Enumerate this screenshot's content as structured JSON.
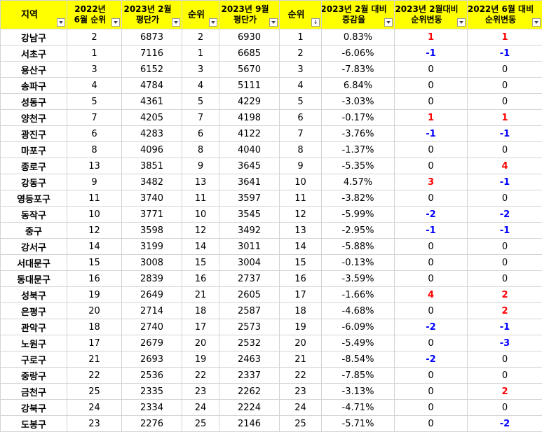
{
  "headers": [
    {
      "line1": "지역",
      "line2": ""
    },
    {
      "line1": "2022년",
      "line2": "6월 순위"
    },
    {
      "line1": "2023년 2월",
      "line2": "평단가"
    },
    {
      "line1": "순위",
      "line2": ""
    },
    {
      "line1": "2023년 9월",
      "line2": "평단가"
    },
    {
      "line1": "순위",
      "line2": ""
    },
    {
      "line1": "2023년 2월 대비",
      "line2": "증감율"
    },
    {
      "line1": "2023년 2월대비",
      "line2": "순위변동"
    },
    {
      "line1": "2022년 6월 대비",
      "line2": "순위변동"
    }
  ],
  "rows": [
    [
      "강남구",
      "2",
      "6873",
      "2",
      "6930",
      "1",
      "0.83%",
      "1",
      "1"
    ],
    [
      "서초구",
      "1",
      "7116",
      "1",
      "6685",
      "2",
      "-6.06%",
      "-1",
      "-1"
    ],
    [
      "용산구",
      "3",
      "6152",
      "3",
      "5670",
      "3",
      "-7.83%",
      "0",
      "0"
    ],
    [
      "송파구",
      "4",
      "4784",
      "4",
      "5111",
      "4",
      "6.84%",
      "0",
      "0"
    ],
    [
      "성동구",
      "5",
      "4361",
      "5",
      "4229",
      "5",
      "-3.03%",
      "0",
      "0"
    ],
    [
      "양천구",
      "7",
      "4205",
      "7",
      "4198",
      "6",
      "-0.17%",
      "1",
      "1"
    ],
    [
      "광진구",
      "6",
      "4283",
      "6",
      "4122",
      "7",
      "-3.76%",
      "-1",
      "-1"
    ],
    [
      "마포구",
      "8",
      "4096",
      "8",
      "4040",
      "8",
      "-1.37%",
      "0",
      "0"
    ],
    [
      "종로구",
      "13",
      "3851",
      "9",
      "3645",
      "9",
      "-5.35%",
      "0",
      "4"
    ],
    [
      "강동구",
      "9",
      "3482",
      "13",
      "3641",
      "10",
      "4.57%",
      "3",
      "-1"
    ],
    [
      "영등포구",
      "11",
      "3740",
      "11",
      "3597",
      "11",
      "-3.82%",
      "0",
      "0"
    ],
    [
      "동작구",
      "10",
      "3771",
      "10",
      "3545",
      "12",
      "-5.99%",
      "-2",
      "-2"
    ],
    [
      "중구",
      "12",
      "3598",
      "12",
      "3492",
      "13",
      "-2.95%",
      "-1",
      "-1"
    ],
    [
      "강서구",
      "14",
      "3199",
      "14",
      "3011",
      "14",
      "-5.88%",
      "0",
      "0"
    ],
    [
      "서대문구",
      "15",
      "3008",
      "15",
      "3004",
      "15",
      "-0.13%",
      "0",
      "0"
    ],
    [
      "동대문구",
      "16",
      "2839",
      "16",
      "2737",
      "16",
      "-3.59%",
      "0",
      "0"
    ],
    [
      "성북구",
      "19",
      "2649",
      "21",
      "2605",
      "17",
      "-1.66%",
      "4",
      "2"
    ],
    [
      "은평구",
      "20",
      "2714",
      "18",
      "2587",
      "18",
      "-4.68%",
      "0",
      "2"
    ],
    [
      "관악구",
      "18",
      "2740",
      "17",
      "2573",
      "19",
      "-6.09%",
      "-2",
      "-1"
    ],
    [
      "노원구",
      "17",
      "2679",
      "20",
      "2532",
      "20",
      "-5.49%",
      "0",
      "-3"
    ],
    [
      "구로구",
      "21",
      "2693",
      "19",
      "2463",
      "21",
      "-8.54%",
      "-2",
      "0"
    ],
    [
      "중랑구",
      "22",
      "2536",
      "22",
      "2337",
      "22",
      "-7.85%",
      "0",
      "0"
    ],
    [
      "금천구",
      "25",
      "2335",
      "23",
      "2262",
      "23",
      "-3.13%",
      "0",
      "2"
    ],
    [
      "강북구",
      "24",
      "2334",
      "24",
      "2224",
      "24",
      "-4.71%",
      "0",
      "0"
    ],
    [
      "도봉구",
      "23",
      "2276",
      "25",
      "2146",
      "25",
      "-5.71%",
      "0",
      "-2"
    ]
  ],
  "icons": {
    "filter": "filter-dropdown-icon",
    "sorted_filter": "sort-filter-icon"
  },
  "colors": {
    "header_bg": "#ffff00",
    "positive_change": "#ff0000",
    "negative_change": "#0000ff",
    "grid": "#d4d4d4"
  }
}
